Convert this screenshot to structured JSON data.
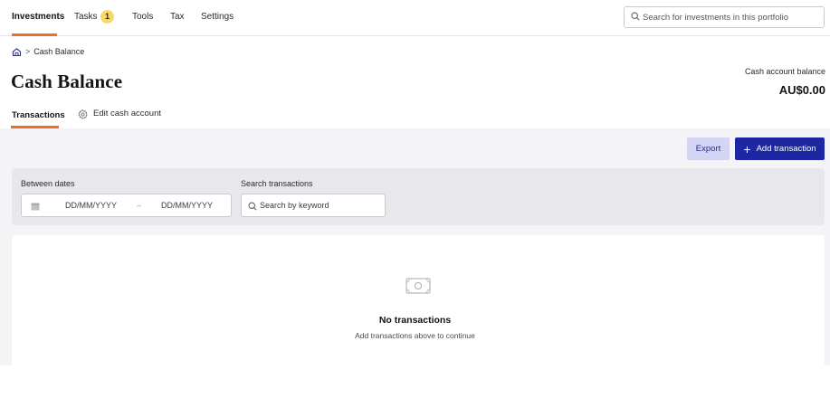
{
  "nav": {
    "items": [
      {
        "label": "Investments"
      },
      {
        "label": "Tasks"
      },
      {
        "label": "Tools"
      },
      {
        "label": "Tax"
      },
      {
        "label": "Settings"
      }
    ],
    "tasks_badge": "1",
    "search_placeholder": "Search for investments in this portfolio"
  },
  "breadcrumb": {
    "current": "Cash Balance"
  },
  "page": {
    "title": "Cash Balance",
    "balance_label": "Cash account balance",
    "balance_value": "AU$0.00"
  },
  "tabs": {
    "transactions": "Transactions",
    "edit": "Edit cash account"
  },
  "actions": {
    "export": "Export",
    "add": "Add transaction"
  },
  "filters": {
    "dates_label": "Between dates",
    "date_from_placeholder": "DD/MM/YYYY",
    "date_to_placeholder": "DD/MM/YYYY",
    "date_separator": "–",
    "search_label": "Search transactions",
    "search_placeholder": "Search by keyword"
  },
  "empty": {
    "title": "No transactions",
    "subtitle": "Add transactions above to continue"
  },
  "colors": {
    "accent": "#f26b2b",
    "primary": "#1e27a3",
    "secondary_bg": "#d4d5f5",
    "badge": "#f9d86a"
  }
}
